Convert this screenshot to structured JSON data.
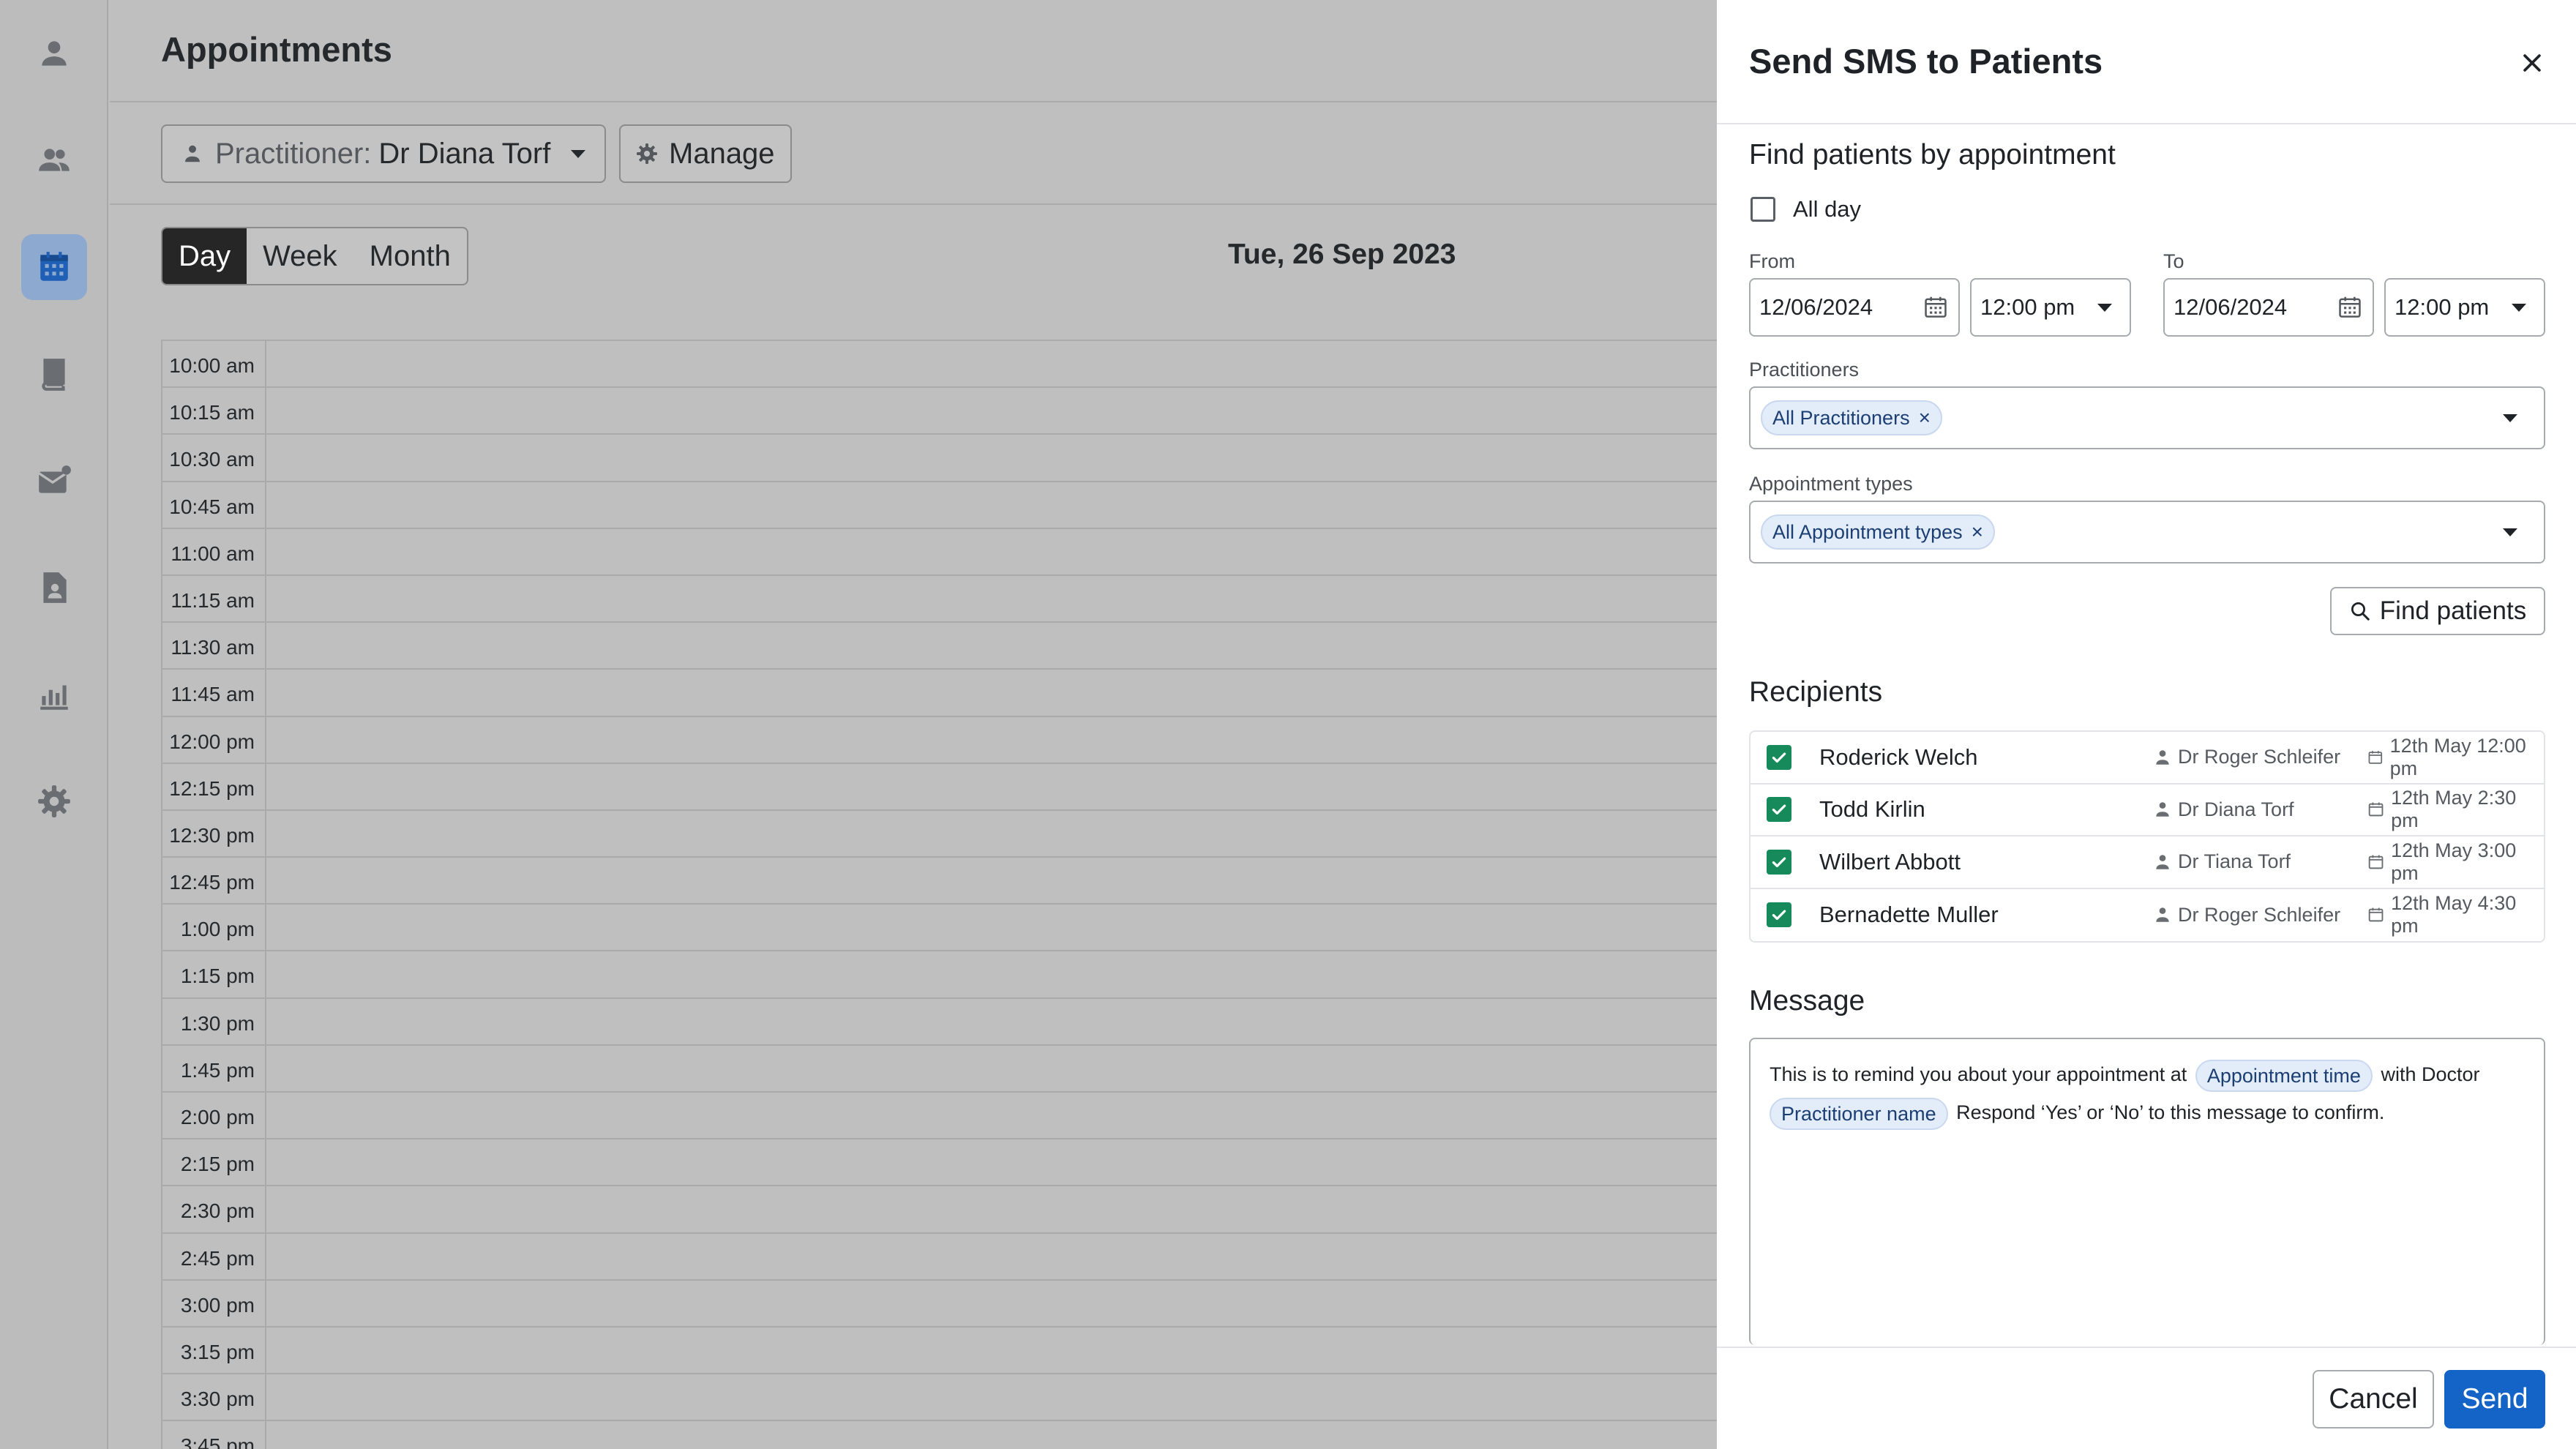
{
  "nav": {
    "items": [
      {
        "icon": "person-icon",
        "active": false
      },
      {
        "icon": "people-icon",
        "active": false
      },
      {
        "icon": "calendar-icon",
        "active": true
      },
      {
        "icon": "book-icon",
        "active": false
      },
      {
        "icon": "mail-icon",
        "active": false
      },
      {
        "icon": "document-icon",
        "active": false
      },
      {
        "icon": "bar-chart-icon",
        "active": false
      },
      {
        "icon": "gear-icon",
        "active": false
      }
    ]
  },
  "main": {
    "title": "Appointments",
    "practitioner_prefix": "Practitioner:",
    "practitioner_value": "Dr Diana Torf",
    "manage_label": "Manage",
    "views": [
      "Day",
      "Week",
      "Month"
    ],
    "active_view": "Day",
    "date": "Tue, 26 Sep 2023",
    "times": [
      "10:00 am",
      "10:15 am",
      "10:30 am",
      "10:45 am",
      "11:00 am",
      "11:15 am",
      "11:30 am",
      "11:45 am",
      "12:00 pm",
      "12:15 pm",
      "12:30 pm",
      "12:45 pm",
      "1:00 pm",
      "1:15 pm",
      "1:30 pm",
      "1:45 pm",
      "2:00 pm",
      "2:15 pm",
      "2:30 pm",
      "2:45 pm",
      "3:00 pm",
      "3:15 pm",
      "3:30 pm",
      "3:45 pm"
    ]
  },
  "drawer": {
    "title": "Send SMS to Patients",
    "find_section_title": "Find patients by appointment",
    "all_day_label": "All day",
    "all_day_checked": false,
    "from_label": "From",
    "from_date": "12/06/2024",
    "from_time": "12:00 pm",
    "to_label": "To",
    "to_date": "12/06/2024",
    "to_time": "12:00 pm",
    "practitioners_label": "Practitioners",
    "practitioners_chip": "All Practitioners",
    "appt_types_label": "Appointment types",
    "appt_types_chip": "All Appointment types",
    "find_button": "Find patients",
    "recipients_title": "Recipients",
    "recipients": [
      {
        "name": "Roderick Welch",
        "practitioner": "Dr Roger Schleifer",
        "time": "12th May 12:00 pm",
        "checked": true
      },
      {
        "name": "Todd Kirlin",
        "practitioner": "Dr Diana Torf",
        "time": "12th May 2:30 pm",
        "checked": true
      },
      {
        "name": "Wilbert Abbott",
        "practitioner": "Dr Tiana Torf",
        "time": "12th May 3:00 pm",
        "checked": true
      },
      {
        "name": "Bernadette Muller",
        "practitioner": "Dr Roger Schleifer",
        "time": "12th May 4:30 pm",
        "checked": true
      }
    ],
    "message_title": "Message",
    "message": {
      "part1": "This is to remind you about your appointment at",
      "tag1": "Appointment time",
      "part2": "with Doctor",
      "tag2": "Practitioner name",
      "part3": "Respond ‘Yes’ or ‘No’ to this message to confirm."
    },
    "cancel_label": "Cancel",
    "send_label": "Send"
  },
  "colors": {
    "accent": "#1464c8",
    "check_green": "#168a5a",
    "chip_bg": "#e3ecf9",
    "overlay_gray": "#bfbfbf"
  }
}
